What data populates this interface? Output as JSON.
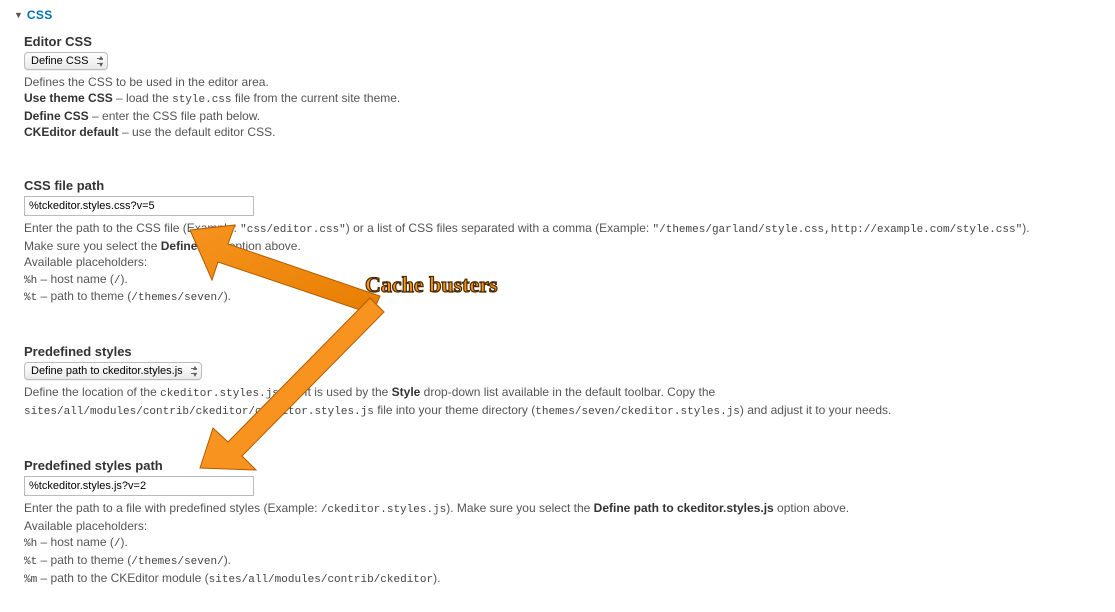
{
  "fieldset": {
    "title": "CSS"
  },
  "editor_css": {
    "label": "Editor CSS",
    "select_value": "Define CSS",
    "desc_line1": "Defines the CSS to be used in the editor area.",
    "opt1_label": "Use theme CSS",
    "opt1_rest_a": " – load the ",
    "opt1_code": "style.css",
    "opt1_rest_b": " file from the current site theme.",
    "opt2_label": "Define CSS",
    "opt2_rest": " – enter the CSS file path below.",
    "opt3_label": "CKEditor default",
    "opt3_rest": " – use the default editor CSS."
  },
  "css_path": {
    "label": "CSS file path",
    "value": "%tckeditor.styles.css?v=5",
    "desc_a": "Enter the path to the CSS file (Example: ",
    "desc_code1": "\"css/editor.css\"",
    "desc_b": ") or a list of CSS files separated with a comma (Example: ",
    "desc_code2": "\"/themes/garland/style.css,http://example.com/style.css\"",
    "desc_c": ").",
    "desc_line2_a": "Make sure you select the ",
    "desc_line2_bold": "Define CSS",
    "desc_line2_b": " option above.",
    "placeholders_label": "Available placeholders:",
    "ph1_code": "%h",
    "ph1_text": " – host name (",
    "ph1_val": "/",
    "ph1_end": ").",
    "ph2_code": "%t",
    "ph2_text": " – path to theme (",
    "ph2_val": "/themes/seven/",
    "ph2_end": ")."
  },
  "predef_styles": {
    "label": "Predefined styles",
    "select_value": "Define path to ckeditor.styles.js",
    "desc_a": "Define the location of the ",
    "desc_code1": "ckeditor.styles.js",
    "desc_b": " file. It is used by the ",
    "desc_bold": "Style",
    "desc_c": " drop-down list available in the default toolbar. Copy the ",
    "desc_code2": "sites/all/modules/contrib/ckeditor/ckeditor.styles.js",
    "desc_d": " file into your theme directory (",
    "desc_code3": "themes/seven/ckeditor.styles.js",
    "desc_e": ") and adjust it to your needs."
  },
  "predef_path": {
    "label": "Predefined styles path",
    "value": "%tckeditor.styles.js?v=2",
    "desc_a": "Enter the path to a file with predefined styles (Example: ",
    "desc_code1": "/ckeditor.styles.js",
    "desc_b": "). Make sure you select the ",
    "desc_bold": "Define path to ckeditor.styles.js",
    "desc_c": " option above.",
    "placeholders_label": "Available placeholders:",
    "ph1_code": "%h",
    "ph1_text": " – host name (",
    "ph1_val": "/",
    "ph1_end": ").",
    "ph2_code": "%t",
    "ph2_text": " – path to theme (",
    "ph2_val": "/themes/seven/",
    "ph2_end": ").",
    "ph3_code": "%m",
    "ph3_text": " – path to the CKEditor module (",
    "ph3_val": "sites/all/modules/contrib/ckeditor",
    "ph3_end": ")."
  },
  "annotation": {
    "label": "Cache busters"
  }
}
